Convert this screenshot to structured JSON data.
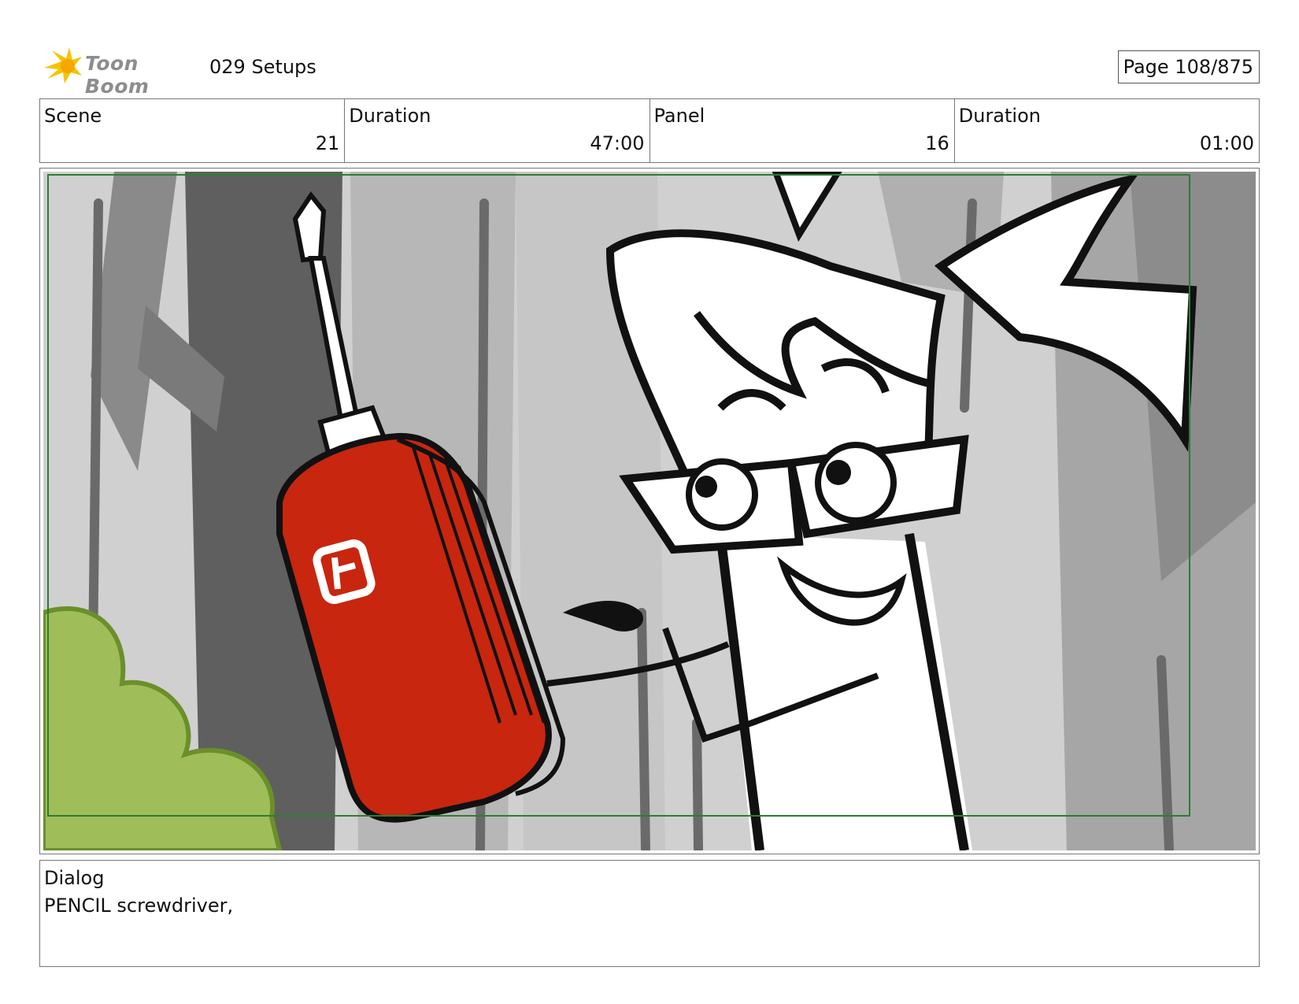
{
  "header": {
    "logo_text": "Toon Boom",
    "project_title": "029 Setups",
    "page_label": "Page 108/875"
  },
  "info": {
    "scene_label": "Scene",
    "scene_value": "21",
    "scene_duration_label": "Duration",
    "scene_duration_value": "47:00",
    "panel_label": "Panel",
    "panel_value": "16",
    "panel_duration_label": "Duration",
    "panel_duration_value": "01:00"
  },
  "dialog": {
    "label": "Dialog",
    "text": "PENCIL screwdriver,"
  },
  "colors": {
    "logo_yellow": "#f5c400",
    "tool_red": "#c8260e",
    "bush_green": "#9fbe5a",
    "frame_green": "#2e7d32",
    "bg_gray": "#cfcfcf"
  }
}
